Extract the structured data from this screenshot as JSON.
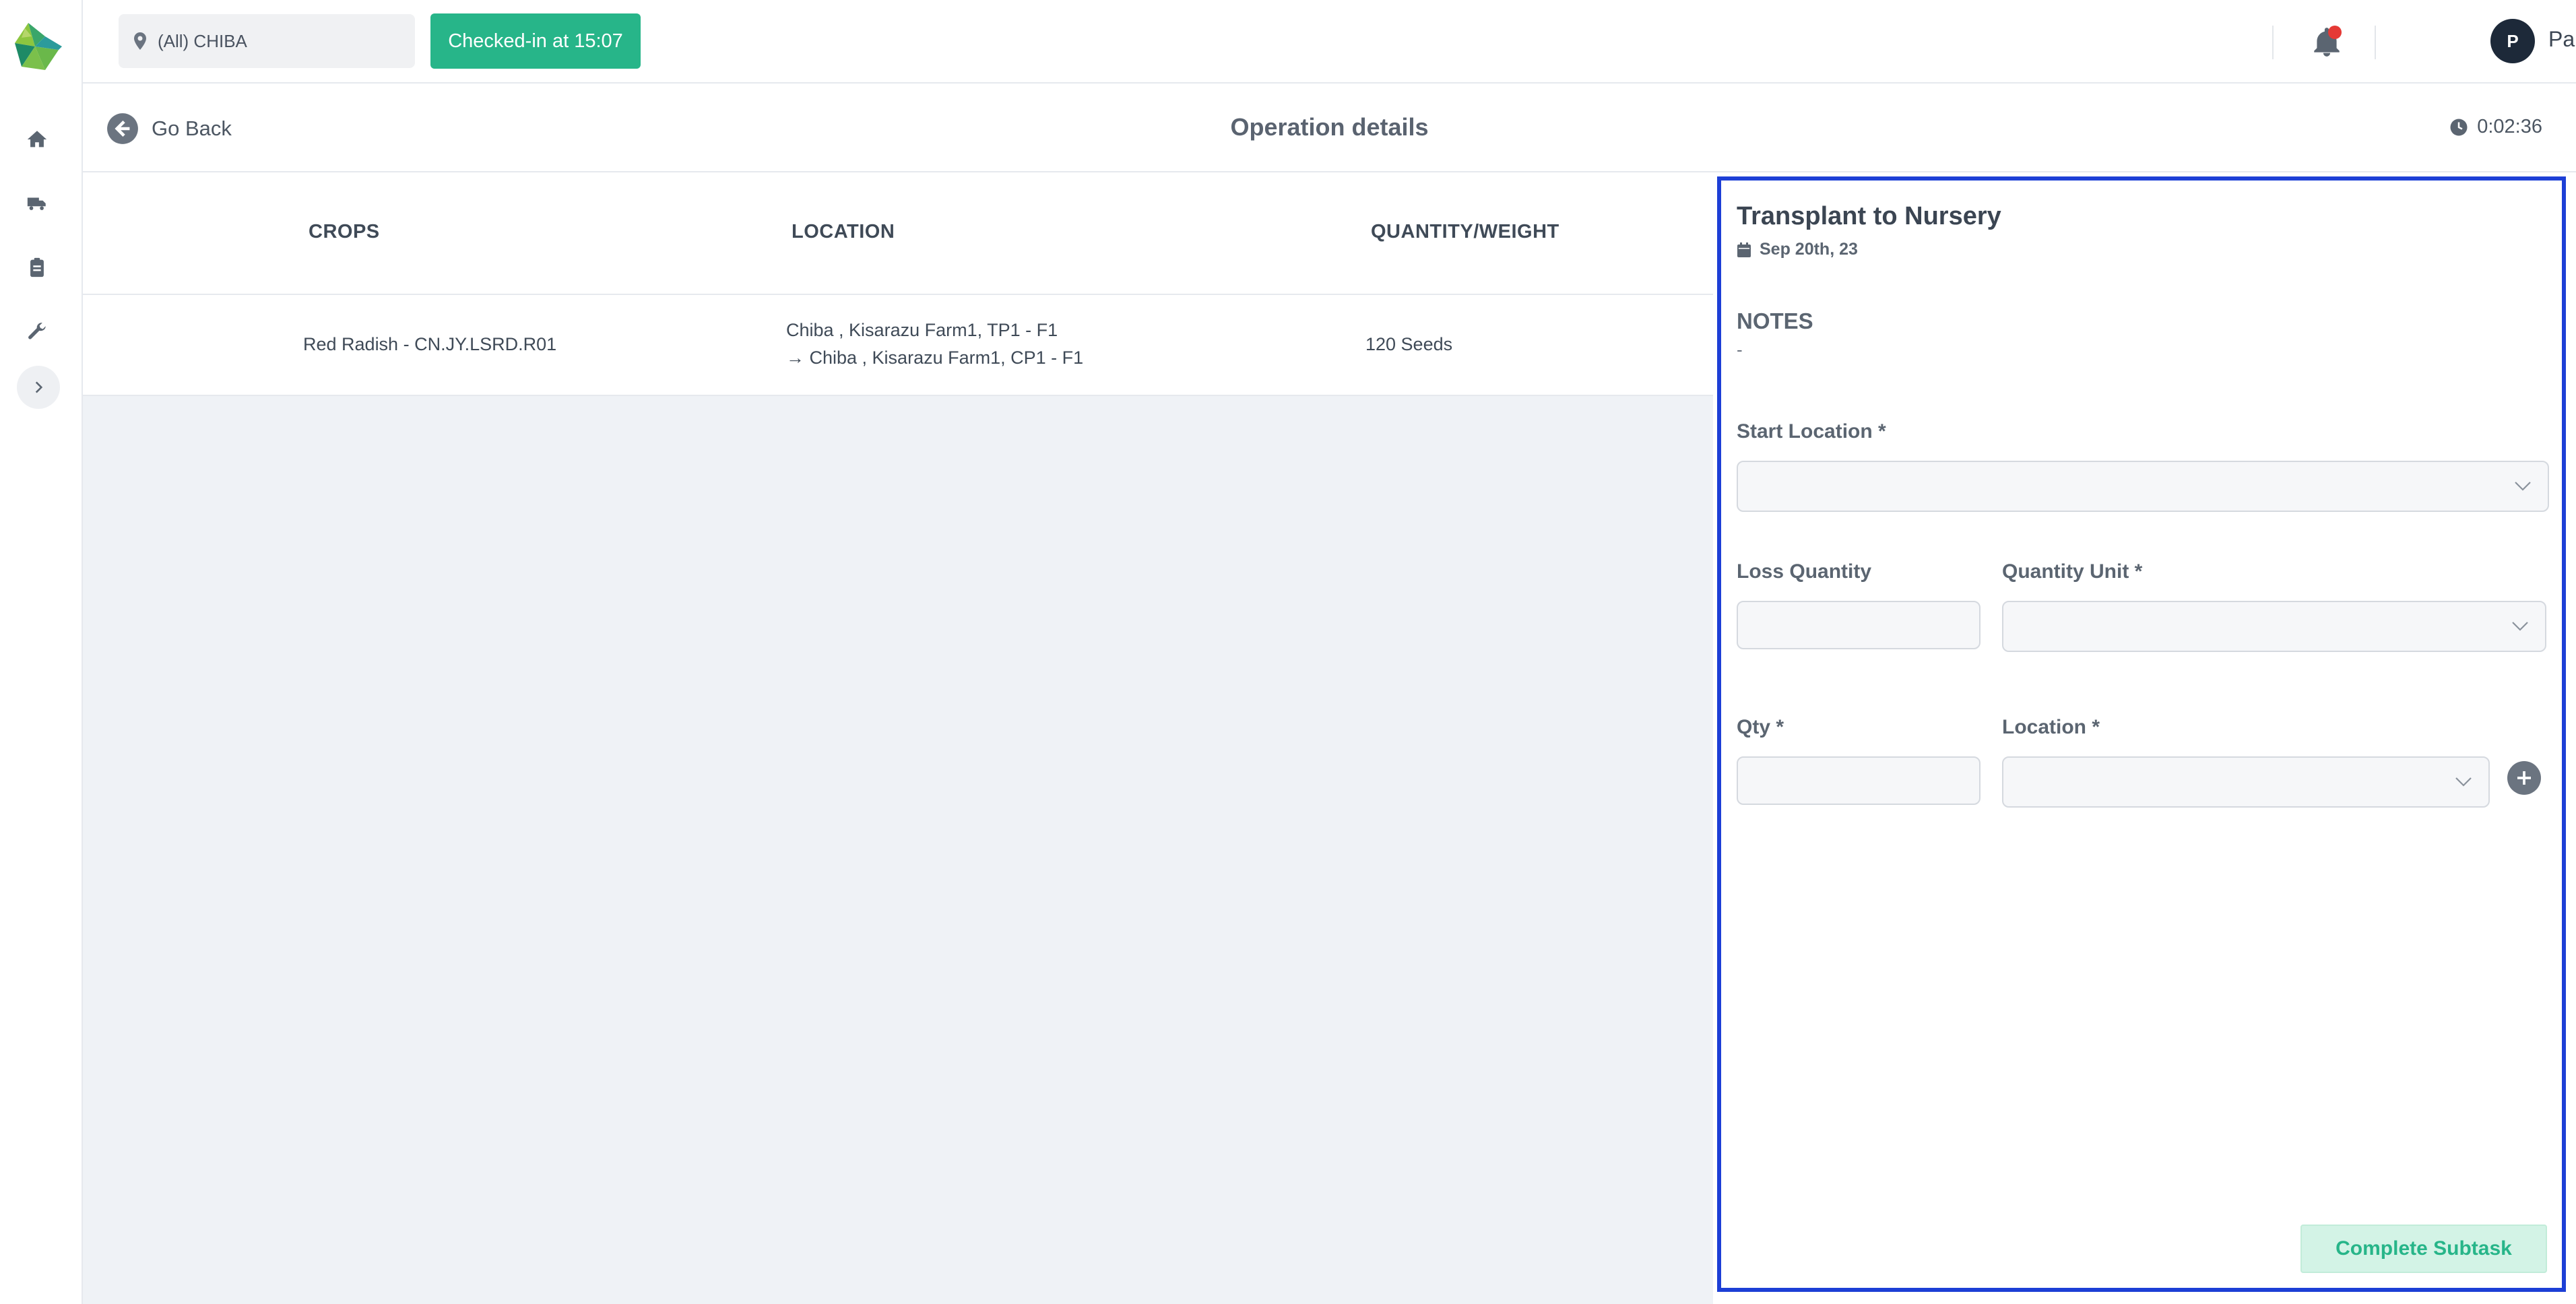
{
  "header": {
    "site_select_value": "(All) CHIBA",
    "checkin_label": "Checked-in at 15:07",
    "user_initial": "P",
    "user_name": "Paul"
  },
  "subheader": {
    "go_back_label": "Go Back",
    "title": "Operation details",
    "timer": "0:02:36"
  },
  "sidebar": {
    "items": [
      {
        "icon": "home-icon"
      },
      {
        "icon": "truck-icon"
      },
      {
        "icon": "clipboard-icon"
      },
      {
        "icon": "wrench-icon"
      }
    ]
  },
  "table": {
    "columns": [
      "CROPS",
      "LOCATION",
      "QUANTITY/WEIGHT"
    ],
    "rows": [
      {
        "crop": "Red Radish - CN.JY.LSRD.R01",
        "location_from": "Chiba , Kisarazu Farm1, TP1 - F1",
        "location_to": "→ Chiba , Kisarazu Farm1, CP1 - F1",
        "quantity": "120 Seeds"
      }
    ]
  },
  "panel": {
    "title": "Transplant to Nursery",
    "date": "Sep 20th, 23",
    "notes_label": "NOTES",
    "notes_value": "-",
    "start_location_label": "Start Location *",
    "loss_quantity_label": "Loss Quantity",
    "quantity_unit_label": "Quantity Unit *",
    "qty_label": "Qty *",
    "location_label": "Location *",
    "complete_button": "Complete Subtask"
  },
  "colors": {
    "accent_green": "#27b589",
    "panel_border": "#1d3fd6",
    "notification_dot": "#e53935"
  }
}
